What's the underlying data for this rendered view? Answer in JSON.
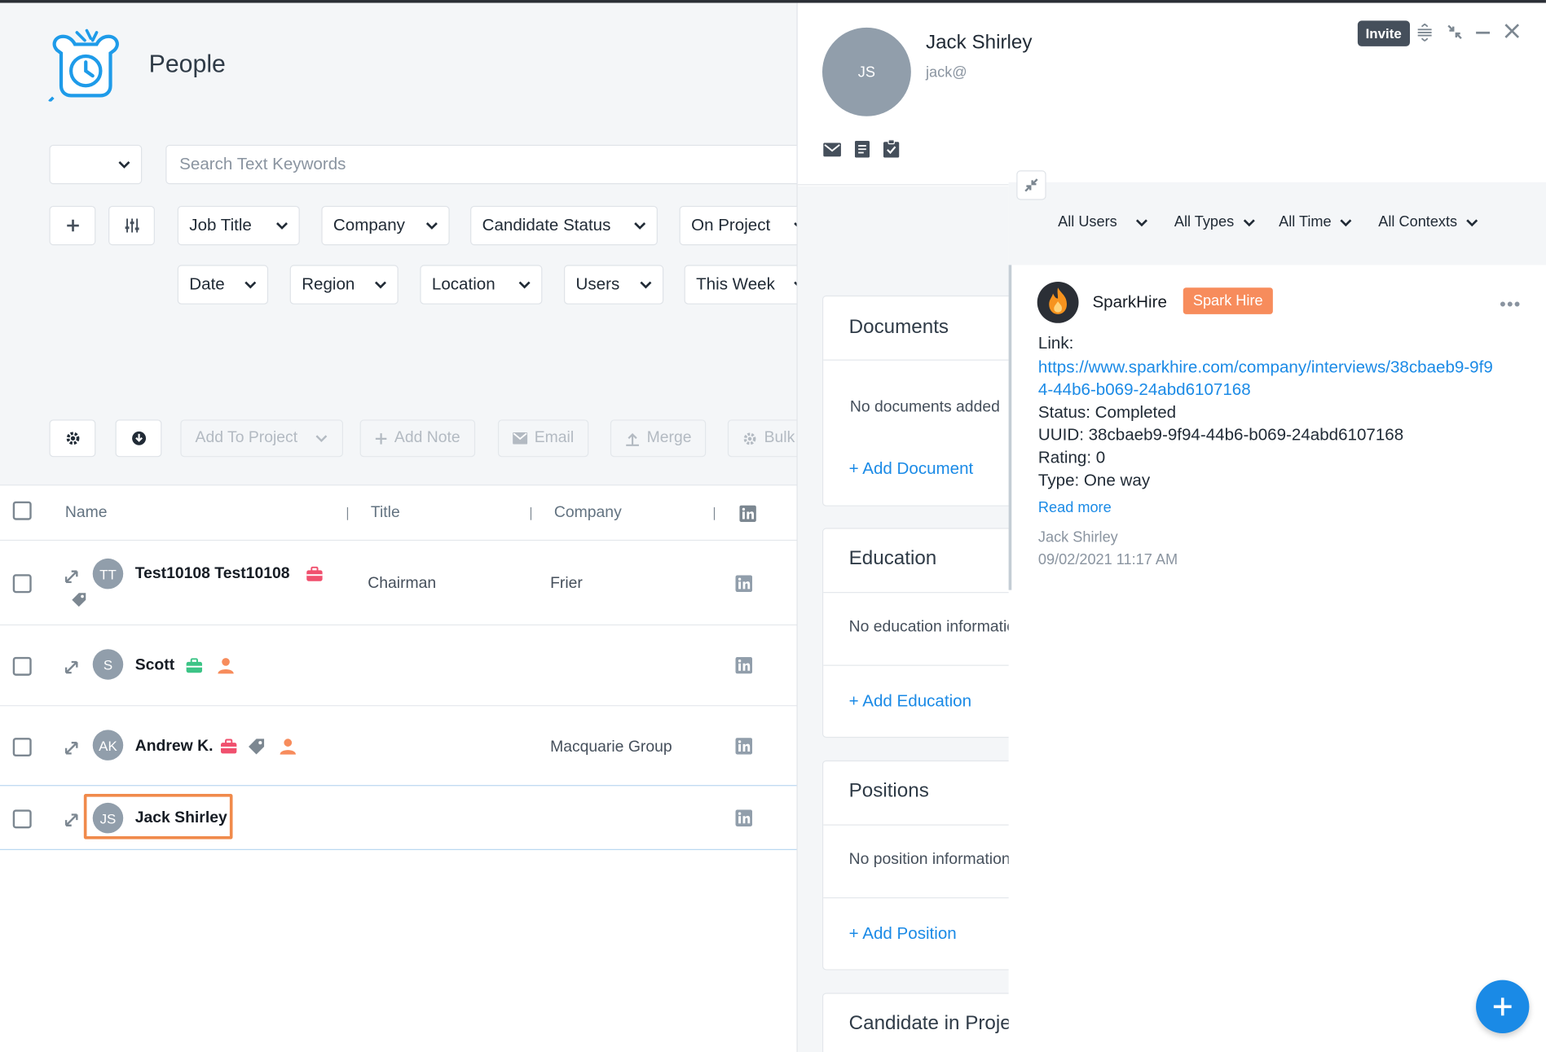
{
  "page": {
    "title": "People",
    "search_placeholder": "Search Text Keywords",
    "select_value": ""
  },
  "filters_row1": [
    "Job Title",
    "Company",
    "Candidate Status",
    "On Project"
  ],
  "filters_row2": [
    "Date",
    "Region",
    "Location",
    "Users",
    "This Week"
  ],
  "actions": {
    "add_to_project": "Add To Project",
    "add_note": "Add Note",
    "email": "Email",
    "merge": "Merge",
    "bulk": "Bulk"
  },
  "table": {
    "headers": {
      "name": "Name",
      "title": "Title",
      "company": "Company"
    },
    "rows": [
      {
        "initials": "TT",
        "name": "Test10108 Test10108",
        "title": "Chairman",
        "company": "Frier"
      },
      {
        "initials": "S",
        "name": "Scott",
        "title": "",
        "company": ""
      },
      {
        "initials": "AK",
        "name": "Andrew K.",
        "title": "",
        "company": "Macquarie Group"
      },
      {
        "initials": "JS",
        "name": "Jack Shirley",
        "title": "",
        "company": ""
      }
    ]
  },
  "drawer": {
    "initials": "JS",
    "name": "Jack Shirley",
    "email": "jack@",
    "invite_label": "Invite",
    "cards": {
      "documents": {
        "title": "Documents",
        "empty": "No documents added",
        "add": "+ Add Document"
      },
      "education": {
        "title": "Education",
        "empty": "No education information",
        "add": "+ Add Education"
      },
      "positions": {
        "title": "Positions",
        "empty": "No position information",
        "add": "+ Add Position"
      },
      "projects": {
        "title": "Candidate in Projects"
      }
    },
    "activity_filters": [
      "All Users",
      "All Types",
      "All Time",
      "All Contexts"
    ],
    "activity": {
      "source": "SparkHire",
      "badge": "Spark Hire",
      "link_label": "Link:",
      "link_url": "https://www.sparkhire.com/company/interviews/38cbaeb9-9f94-44b6-b069-24abd6107168",
      "status": "Status: Completed",
      "uuid": "UUID: 38cbaeb9-9f94-44b6-b069-24abd6107168",
      "rating": "Rating: 0",
      "type": "Type: One way",
      "read_more": "Read more",
      "author": "Jack Shirley",
      "timestamp": "09/02/2021 11:17 AM"
    }
  },
  "colors": {
    "accent": "#1a8ae6",
    "badge": "#f78c5c",
    "highlight": "#f08a4b",
    "avatar": "#919eab"
  }
}
